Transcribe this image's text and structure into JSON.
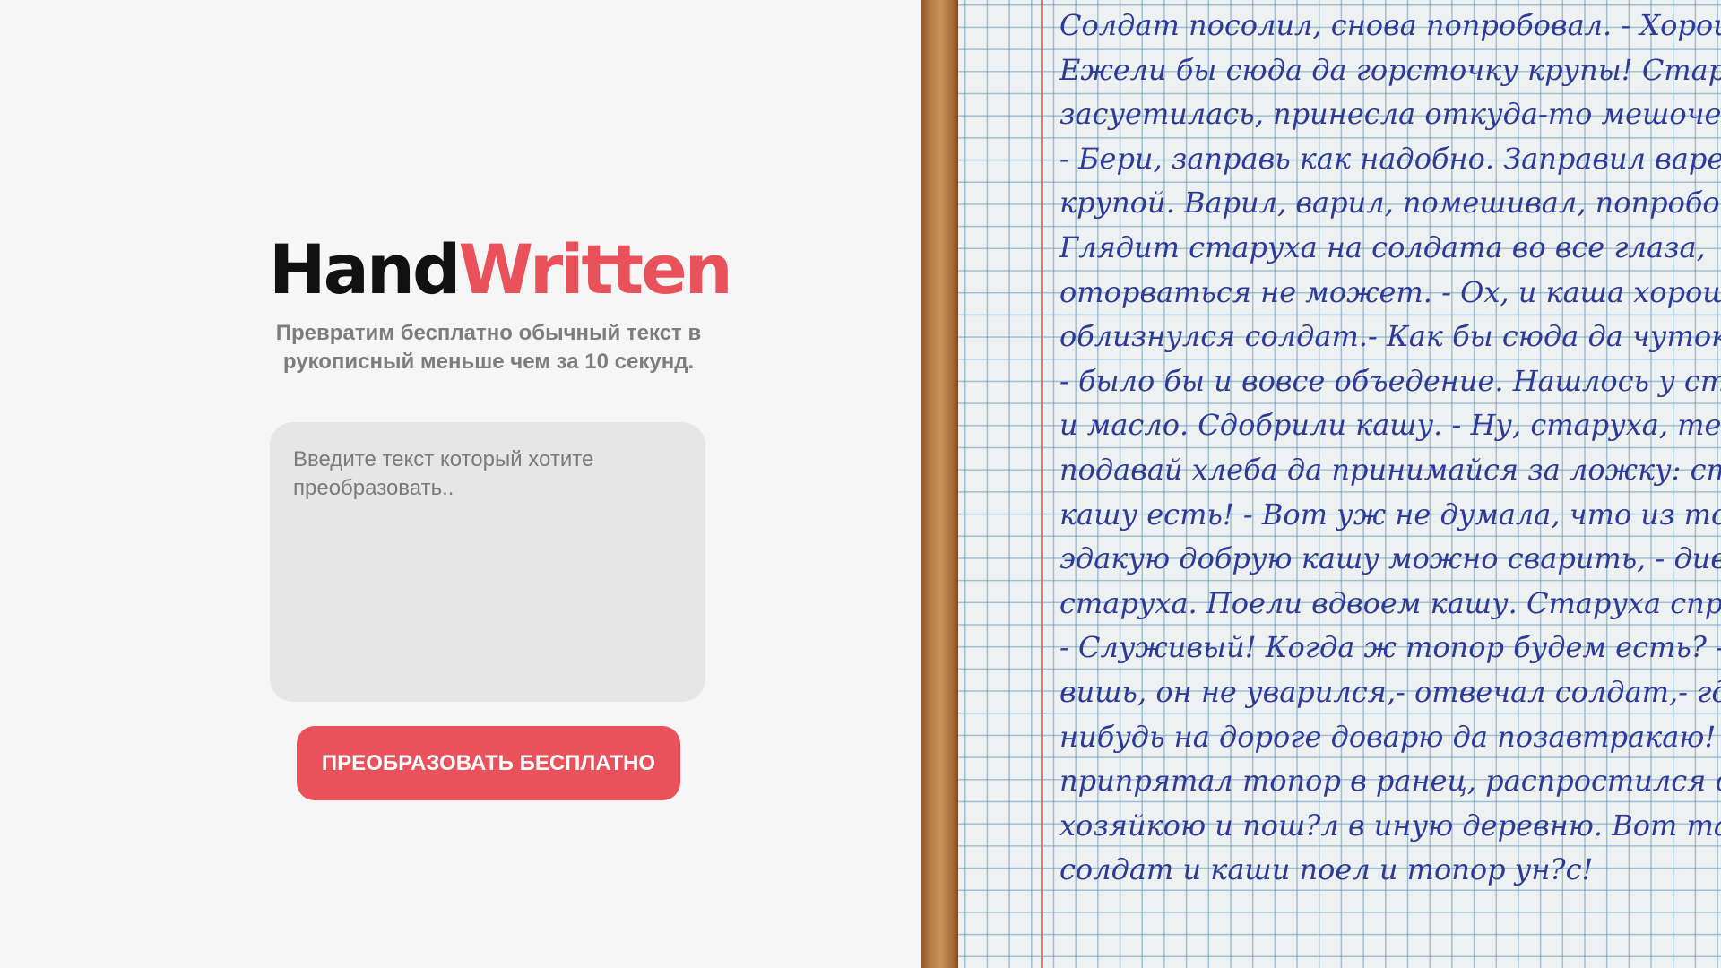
{
  "brand": {
    "part1": "Hand",
    "part2": "Written",
    "subtitle_line1": "Превратим бесплатно обычный текст в",
    "subtitle_line2": "рукописный меньше чем за 10 секунд."
  },
  "input": {
    "placeholder": "Введите текст который хотите преобразовать..",
    "value": ""
  },
  "convert_button": {
    "label": "ПРЕОБРАЗОВАТЬ БЕСПЛАТНО"
  },
  "colors": {
    "accent": "#e9525a",
    "ink": "#2e3a9a",
    "page_background": "#f6f6f6"
  },
  "preview": {
    "lines": [
      "Солдат посолил, снова попробовал. - Хороша!",
      "Ежели бы сюда да горсточку крупы! Старуха",
      "засуетилась, принесла откуда-то мешочек крупы.",
      "- Бери, заправь как надобно. Заправил варево",
      "крупой. Варил, варил, помешивал, попробовал.",
      "Глядит старуха на солдата во все глаза,",
      "оторваться не может. - Ох, и каша хороша! -",
      "облизнулся солдат.- Как бы сюда да чуток масла",
      "- было бы и вовсе объедение. Нашлось у старухи",
      "и масло. Сдобрили кашу. - Ну, старуха, теперь",
      "подавай хлеба да принимайся за ложку: станем",
      "кашу есть! - Вот уж не думала, что из топора",
      "эдакую добрую кашу можно сварить, - дивится",
      "старуха. Поели вдвоем кашу. Старуха спрашивает",
      "- Служивый! Когда ж топор будем есть? - Да,",
      "вишь, он не уварился,- отвечал солдат,- где-",
      "нибудь на дороге доварю да позавтракаю! Тотчас",
      "припрятал топор в ранец, распростился с",
      "хозяйкою и пош?л в иную деревню. Вот так-то",
      "солдат и каши поел и топор ун?с!"
    ]
  }
}
